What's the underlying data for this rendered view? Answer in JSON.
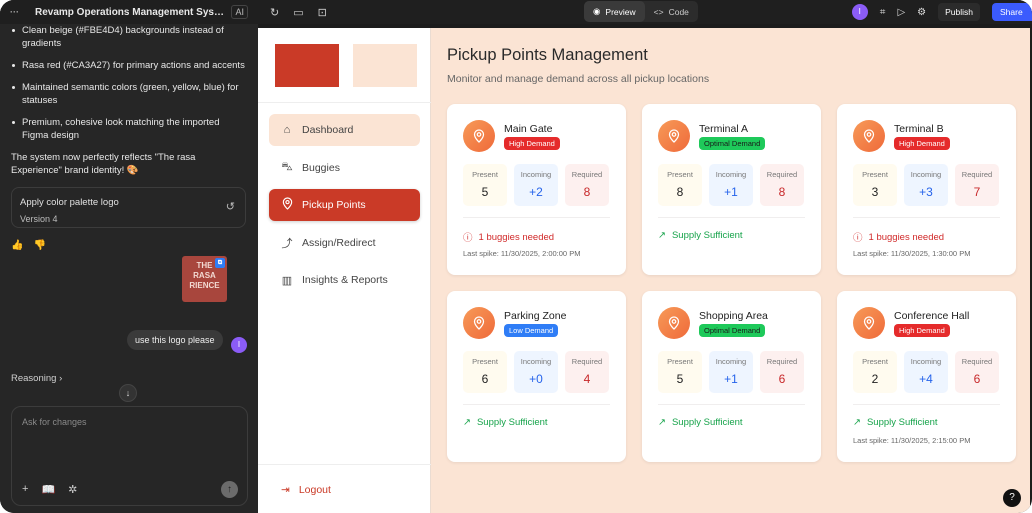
{
  "chat": {
    "menu": "···",
    "title": "Revamp Operations Management Syst...",
    "ai_label": "AI",
    "bullets": [
      "Clean beige (#FBE4D4) backgrounds instead of gradients",
      "Rasa red (#CA3A27) for primary actions and accents",
      "Maintained semantic colors (green, yellow, blue) for statuses",
      "Premium, cohesive look matching the imported Figma design"
    ],
    "summary": "The system now perfectly reflects \"The rasa Experience\" brand identity! 🎨",
    "version_card": {
      "title": "Apply color palette logo",
      "version": "Version 4"
    },
    "logo_text": "THE\nRASA\nRIENCE",
    "user_message": "use this logo please",
    "user_initial": "I",
    "reasoning_label": "Reasoning",
    "composer_placeholder": "Ask for changes"
  },
  "toolbar": {
    "preview_label": "Preview",
    "code_label": "Code",
    "user_initial": "I",
    "publish_label": "Publish",
    "share_label": "Share"
  },
  "app": {
    "brand_colors": [
      "#CA3A27",
      "#FBE4D4"
    ],
    "nav": [
      {
        "label": "Dashboard",
        "icon": "home-icon"
      },
      {
        "label": "Buggies",
        "icon": "car-icon"
      },
      {
        "label": "Pickup Points",
        "icon": "map-pin-icon"
      },
      {
        "label": "Assign/Redirect",
        "icon": "route-icon"
      },
      {
        "label": "Insights & Reports",
        "icon": "bar-chart-icon"
      }
    ],
    "logout_label": "Logout",
    "page_title": "Pickup Points Management",
    "page_subtitle": "Monitor and manage demand across all pickup locations",
    "stat_labels": {
      "present": "Present",
      "incoming": "Incoming",
      "required": "Required"
    },
    "points": [
      {
        "name": "Main Gate",
        "demand": "High Demand",
        "present": "5",
        "incoming": "+2",
        "required": "8",
        "status": "1 buggies needed",
        "spike": "Last spike: 11/30/2025, 2:00:00 PM"
      },
      {
        "name": "Terminal A",
        "demand": "Optimal Demand",
        "present": "8",
        "incoming": "+1",
        "required": "8",
        "status": "Supply Sufficient",
        "spike": ""
      },
      {
        "name": "Terminal B",
        "demand": "High Demand",
        "present": "3",
        "incoming": "+3",
        "required": "7",
        "status": "1 buggies needed",
        "spike": "Last spike: 11/30/2025, 1:30:00 PM"
      },
      {
        "name": "Parking Zone",
        "demand": "Low Demand",
        "present": "6",
        "incoming": "+0",
        "required": "4",
        "status": "Supply Sufficient",
        "spike": ""
      },
      {
        "name": "Shopping Area",
        "demand": "Optimal Demand",
        "present": "5",
        "incoming": "+1",
        "required": "6",
        "status": "Supply Sufficient",
        "spike": ""
      },
      {
        "name": "Conference Hall",
        "demand": "High Demand",
        "present": "2",
        "incoming": "+4",
        "required": "6",
        "status": "Supply Sufficient",
        "spike": "Last spike: 11/30/2025, 2:15:00 PM"
      }
    ]
  }
}
